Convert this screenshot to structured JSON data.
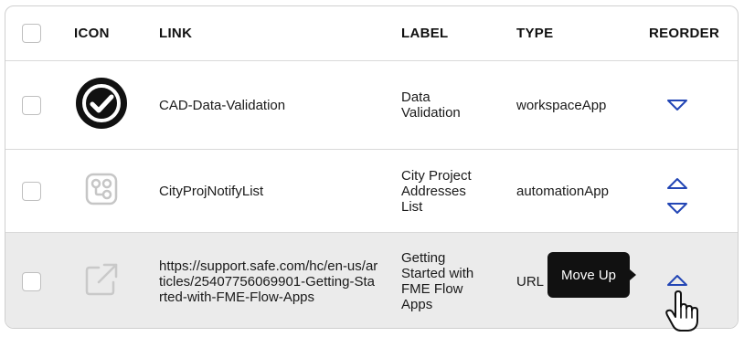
{
  "header": {
    "icon": "ICON",
    "link": "LINK",
    "label": "LABEL",
    "type": "TYPE",
    "reorder": "REORDER"
  },
  "rows": [
    {
      "icon": "check-circle-icon",
      "link": "CAD-Data-Validation",
      "label": "Data Validation",
      "type": "workspaceApp",
      "reorder": [
        "move-down"
      ]
    },
    {
      "icon": "automation-flow-icon",
      "link": "CityProjNotifyList",
      "label": "City Project Addresses List",
      "type": "automationApp",
      "reorder": [
        "move-up",
        "move-down"
      ]
    },
    {
      "icon": "external-link-icon",
      "link": "https://support.safe.com/hc/en-us/articles/25407756069901-Getting-Started-with-FME-Flow-Apps",
      "label": "Getting Started with FME Flow Apps",
      "type": "URL",
      "reorder": [
        "move-up"
      ]
    }
  ],
  "tooltip": {
    "text": "Move Up"
  },
  "colors": {
    "arrow": "#2346b5",
    "hover_row": "#ebebeb",
    "tooltip_bg": "#111111"
  }
}
